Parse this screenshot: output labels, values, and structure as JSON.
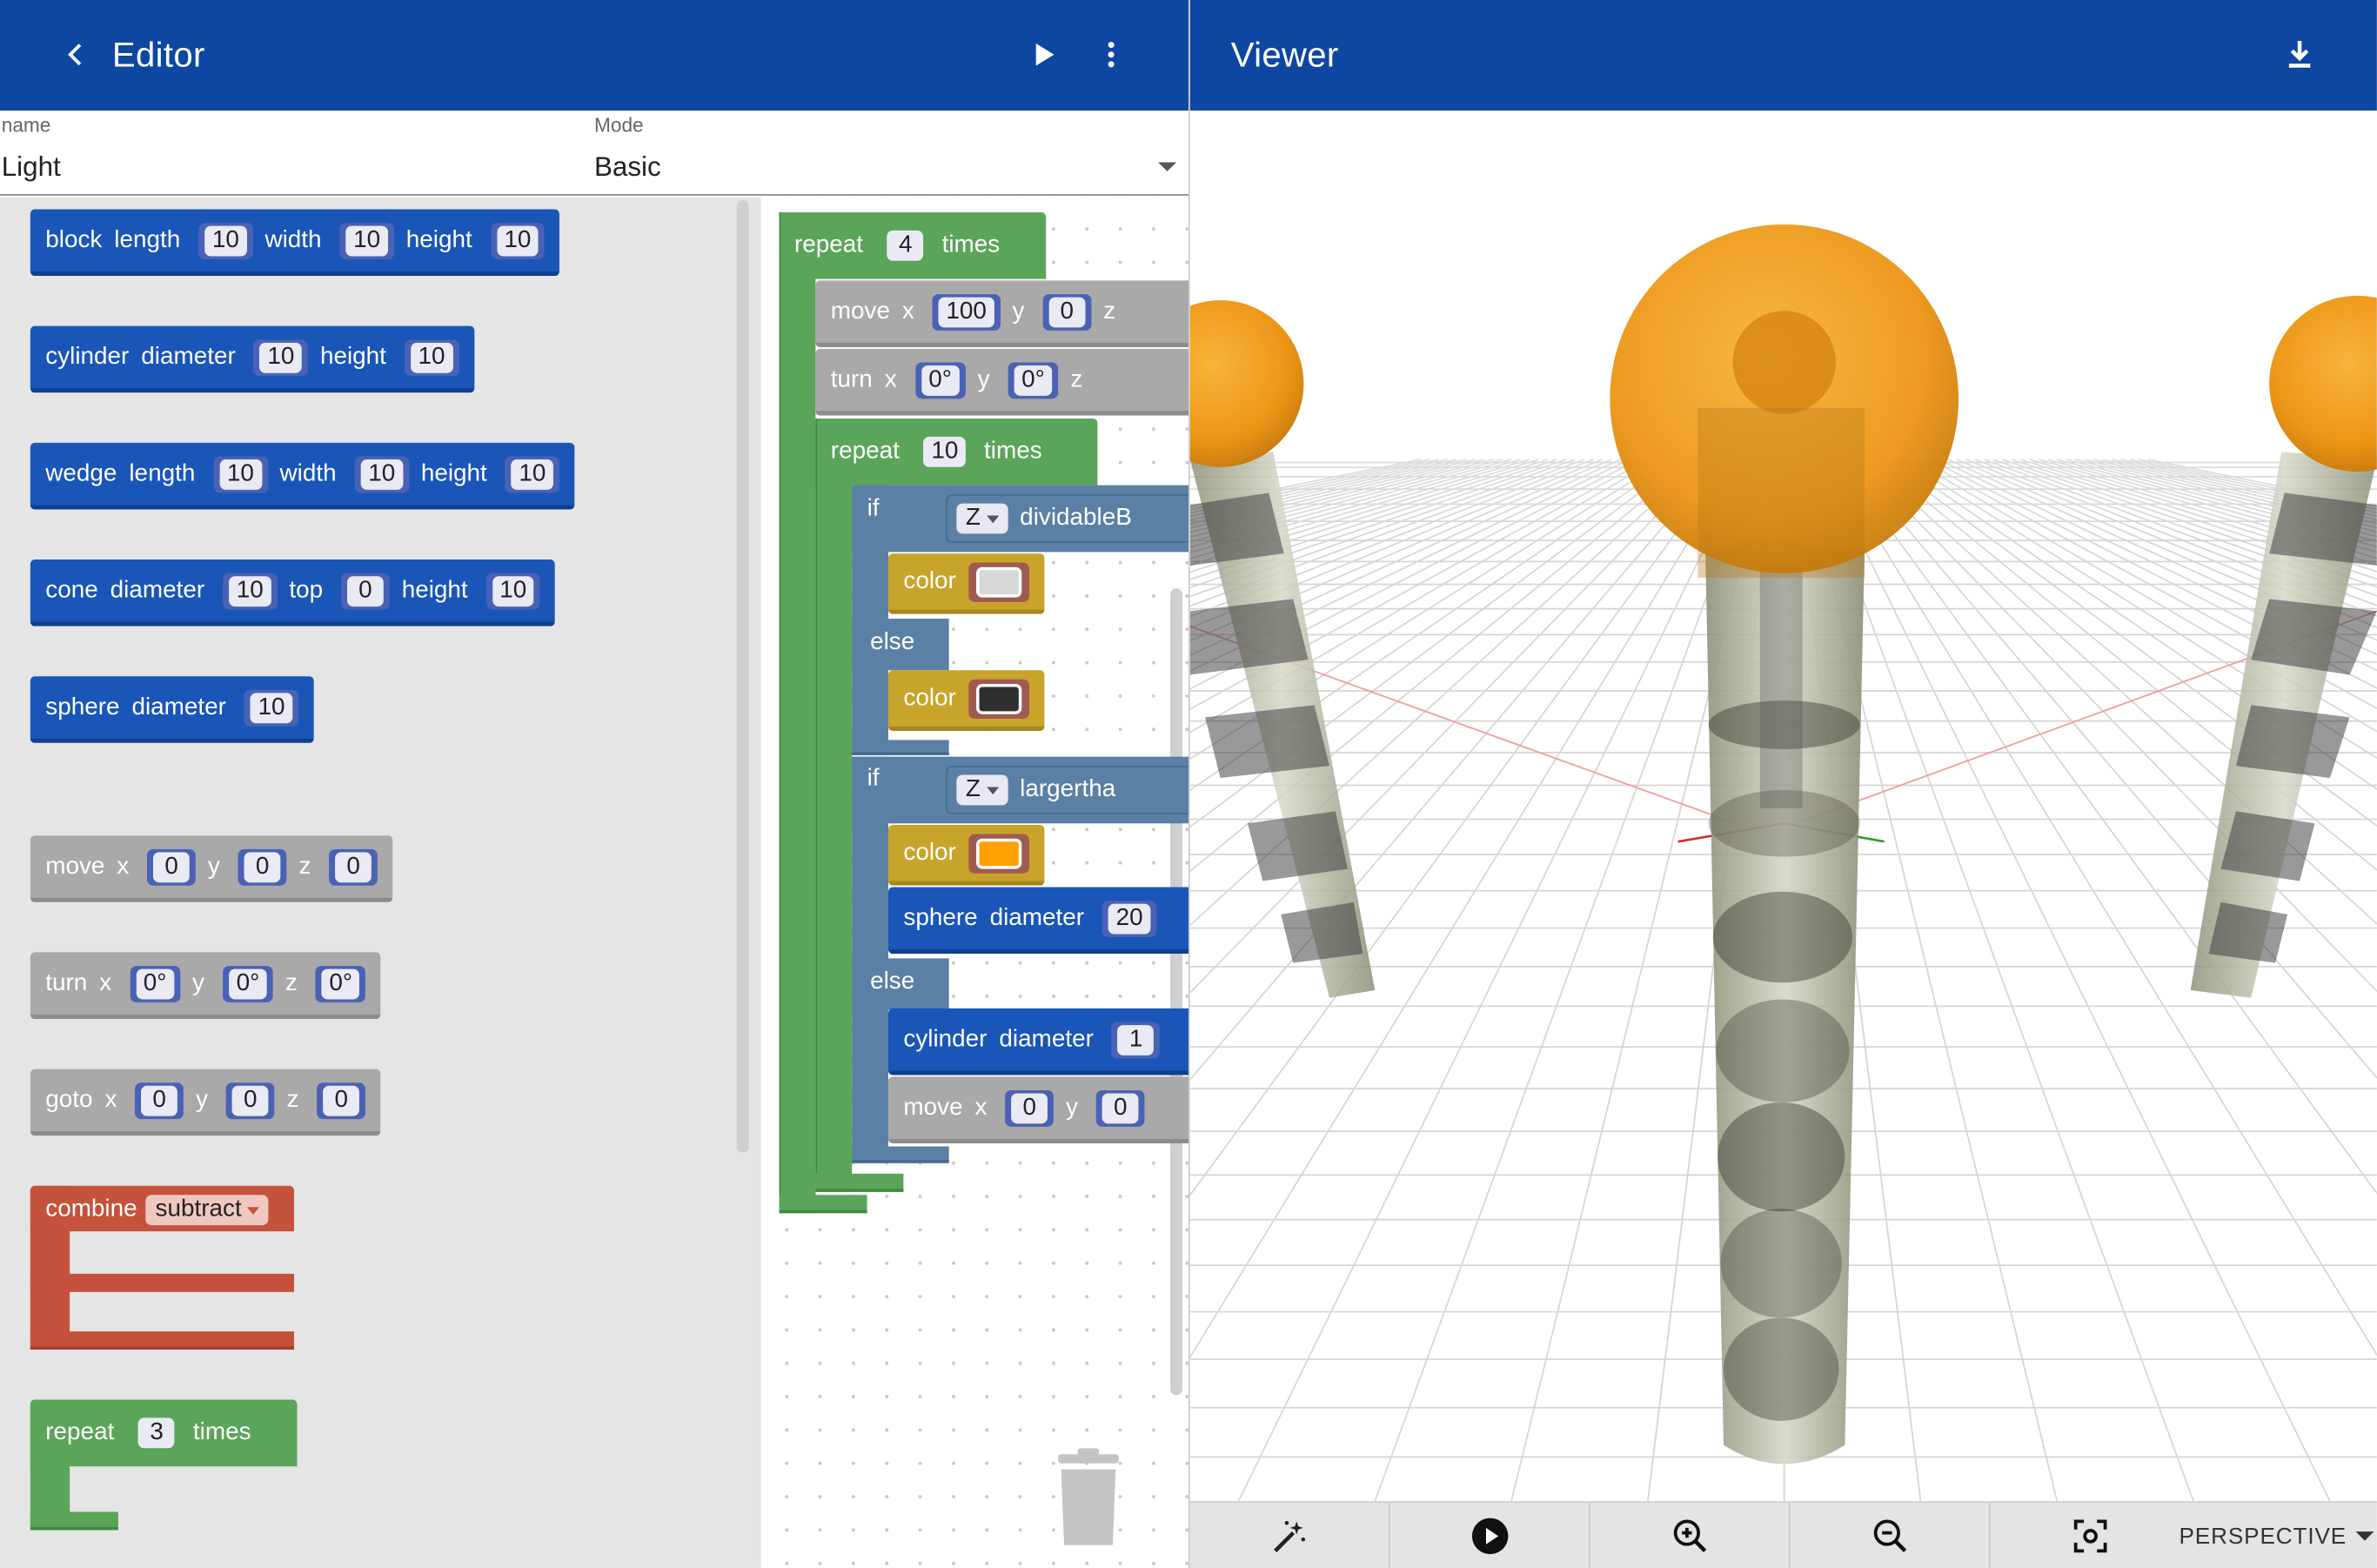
{
  "editor": {
    "title": "Editor",
    "name_label": "name",
    "name_value": "Light",
    "mode_label": "Mode",
    "mode_value": "Basic"
  },
  "viewer": {
    "title": "Viewer",
    "projection": "PERSPECTIVE"
  },
  "icons": {
    "back": "chevron-left-icon",
    "run": "play-icon",
    "menu": "more-vert-icon",
    "download": "download-icon",
    "magic": "magic-wand-icon",
    "play": "play-circle-icon",
    "zoom_in": "zoom-in-icon",
    "zoom_out": "zoom-out-icon",
    "fit": "center-focus-icon",
    "trash": "trash-icon"
  },
  "toolbox": {
    "block": {
      "kw": "block",
      "l1": "length",
      "v1": "10",
      "l2": "width",
      "v2": "10",
      "l3": "height",
      "v3": "10"
    },
    "cylinder": {
      "kw": "cylinder",
      "l1": "diameter",
      "v1": "10",
      "l2": "height",
      "v2": "10"
    },
    "wedge": {
      "kw": "wedge",
      "l1": "length",
      "v1": "10",
      "l2": "width",
      "v2": "10",
      "l3": "height",
      "v3": "10"
    },
    "cone": {
      "kw": "cone",
      "l1": "diameter",
      "v1": "10",
      "l2": "top",
      "v2": "0",
      "l3": "height",
      "v3": "10"
    },
    "sphere": {
      "kw": "sphere",
      "l1": "diameter",
      "v1": "10"
    },
    "move": {
      "kw": "move",
      "l1": "x",
      "v1": "0",
      "l2": "y",
      "v2": "0",
      "l3": "z",
      "v3": "0"
    },
    "turn": {
      "kw": "turn",
      "l1": "x",
      "v1": "0°",
      "l2": "y",
      "v2": "0°",
      "l3": "z",
      "v3": "0°"
    },
    "goto": {
      "kw": "goto",
      "l1": "x",
      "v1": "0",
      "l2": "y",
      "v2": "0",
      "l3": "z",
      "v3": "0"
    },
    "combine": {
      "kw": "combine",
      "op": "subtract"
    },
    "repeat": {
      "kw": "repeat",
      "v1": "3",
      "l2": "times"
    }
  },
  "workspace": {
    "repeat_outer": {
      "kw": "repeat",
      "v": "4",
      "tail": "times"
    },
    "move1": {
      "kw": "move",
      "l1": "x",
      "v1": "100",
      "l2": "y",
      "v2": "0",
      "l3": "z"
    },
    "turn1": {
      "kw": "turn",
      "l1": "x",
      "v1": "0°",
      "l2": "y",
      "v2": "0°",
      "l3": "z"
    },
    "repeat_inner": {
      "kw": "repeat",
      "v": "10",
      "tail": "times"
    },
    "if1": {
      "kw": "if",
      "var": "Z",
      "fn": "dividableB"
    },
    "color_light": {
      "kw": "color",
      "hex": "#d8d8d8"
    },
    "else1": "else",
    "color_dark": {
      "kw": "color",
      "hex": "#2e2e2e"
    },
    "if2": {
      "kw": "if",
      "var": "Z",
      "fn": "largertha"
    },
    "color_orange": {
      "kw": "color",
      "hex": "#ff9f00"
    },
    "sphere2": {
      "kw": "sphere",
      "l1": "diameter",
      "v1": "20"
    },
    "else2": "else",
    "cylinder2": {
      "kw": "cylinder",
      "l1": "diameter",
      "v1": "1"
    },
    "move2": {
      "kw": "move",
      "l1": "x",
      "v1": "0",
      "l2": "y",
      "v2": "0"
    }
  },
  "colors": {
    "appbar": "#0d47a1",
    "shape_block": "#1a56b8",
    "transform_block": "#a9a9a9",
    "loop_block": "#5ba55b",
    "logic_block": "#5b80a5",
    "color_block": "#c8a42a",
    "combine_block": "#c5523c",
    "lamp_orange": "#f29e1c"
  }
}
